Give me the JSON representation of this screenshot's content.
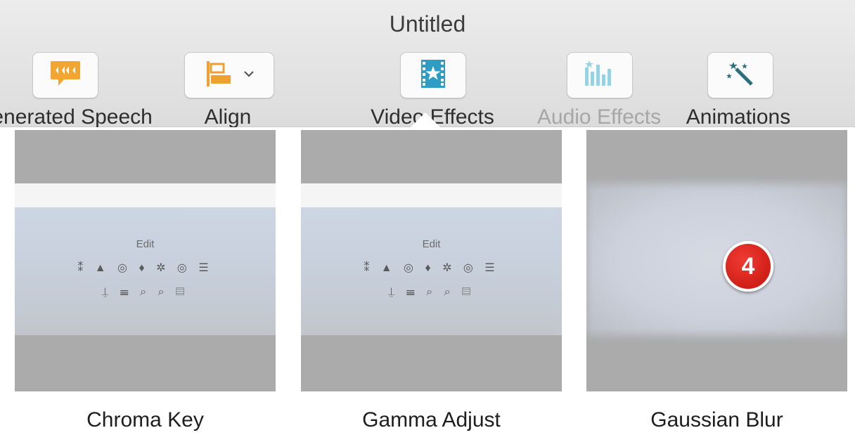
{
  "window": {
    "title": "Untitled"
  },
  "toolbar": {
    "items": [
      {
        "label": "Generated Speech",
        "icon": "speech-bubble-waveform-icon",
        "color": "#f0a030"
      },
      {
        "label": "Align",
        "icon": "align-left-icon",
        "color": "#f0a030"
      },
      {
        "label": "Video Effects",
        "icon": "film-star-icon",
        "color": "#3fa6c8",
        "selected": true
      },
      {
        "label": "Audio Effects",
        "icon": "audio-equalizer-icon",
        "color": "#8fd0e2",
        "disabled": true
      },
      {
        "label": "Animations",
        "icon": "magic-wand-icon",
        "color": "#2a7a8a"
      }
    ]
  },
  "effects": {
    "items": [
      {
        "name": "Chroma Key",
        "preview_text": "Edit"
      },
      {
        "name": "Gamma Adjust",
        "preview_text": "Edit"
      },
      {
        "name": "Gaussian Blur",
        "badge": "4"
      }
    ]
  },
  "colors": {
    "badge": "#d51f18",
    "accent": "#3fa6c8"
  }
}
